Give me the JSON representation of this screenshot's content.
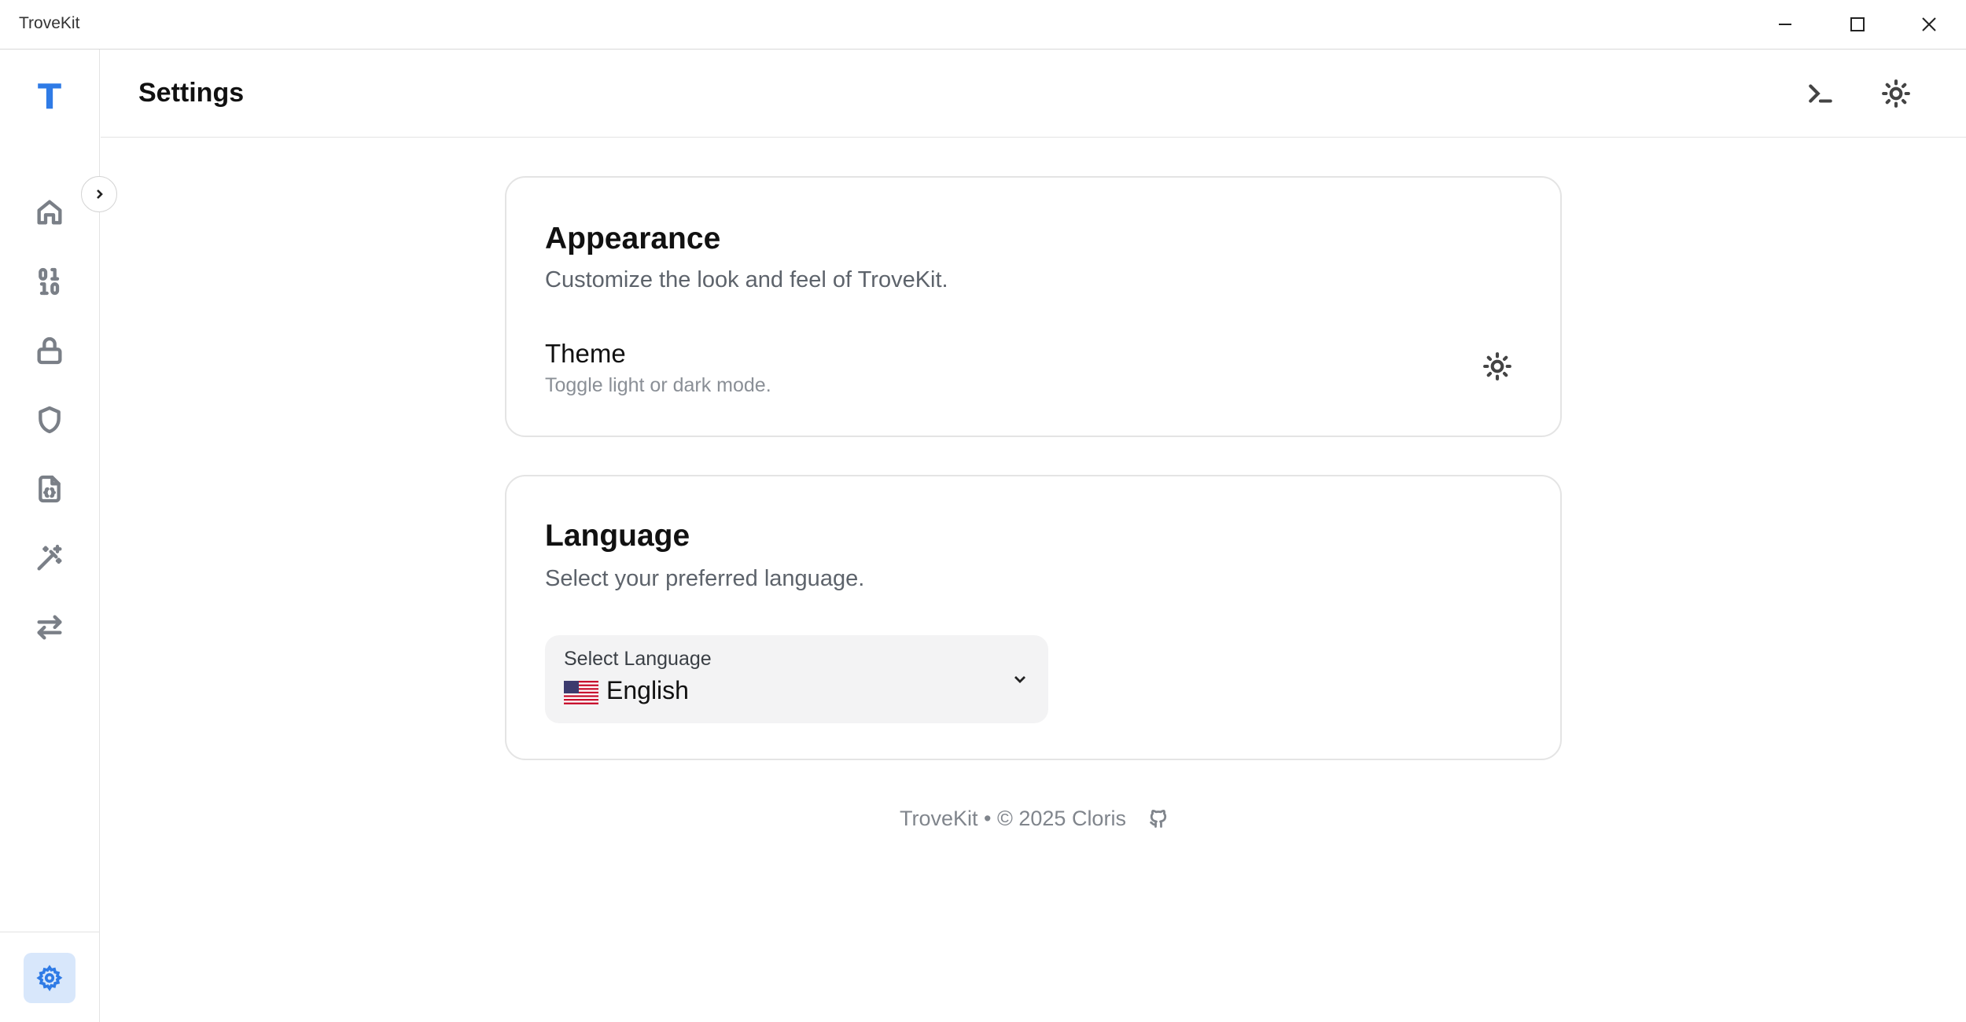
{
  "window": {
    "title": "TroveKit"
  },
  "sidebar": {
    "logo": "T",
    "items": [
      {
        "icon": "home-icon"
      },
      {
        "icon": "binary-icon"
      },
      {
        "icon": "lock-icon"
      },
      {
        "icon": "shield-icon"
      },
      {
        "icon": "file-code-icon"
      },
      {
        "icon": "magic-wand-icon"
      },
      {
        "icon": "arrows-exchange-icon"
      }
    ],
    "active_item": {
      "icon": "gear-icon"
    },
    "accent_color": "#2f7be6"
  },
  "header": {
    "title": "Settings",
    "actions": [
      {
        "icon": "terminal-icon"
      },
      {
        "icon": "sun-icon"
      }
    ]
  },
  "appearance": {
    "title": "Appearance",
    "subtitle": "Customize the look and feel of TroveKit.",
    "theme": {
      "label": "Theme",
      "description": "Toggle light or dark mode.",
      "icon": "sun-icon"
    }
  },
  "language": {
    "title": "Language",
    "subtitle": "Select your preferred language.",
    "select": {
      "label": "Select Language",
      "value": "English",
      "flag": "us-flag-icon"
    }
  },
  "footer": {
    "text": "TroveKit • © 2025 Cloris",
    "icon": "github-icon"
  }
}
